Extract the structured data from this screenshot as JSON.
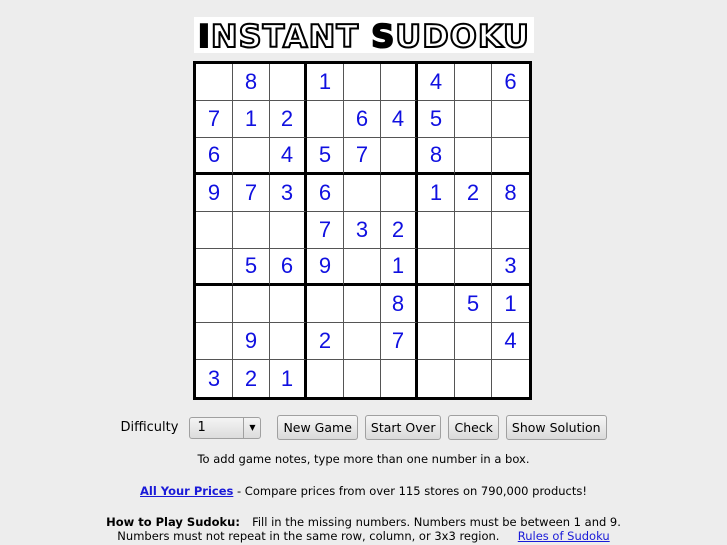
{
  "logo": {
    "text": "INSTANT SUDOKU"
  },
  "grid": [
    [
      "",
      "8",
      "",
      "1",
      "",
      "",
      "4",
      "",
      "6"
    ],
    [
      "7",
      "1",
      "2",
      "",
      "6",
      "4",
      "5",
      "",
      ""
    ],
    [
      "6",
      "",
      "4",
      "5",
      "7",
      "",
      "8",
      "",
      ""
    ],
    [
      "9",
      "7",
      "3",
      "6",
      "",
      "",
      "1",
      "2",
      "8"
    ],
    [
      "",
      "",
      "",
      "7",
      "3",
      "2",
      "",
      "",
      ""
    ],
    [
      "",
      "5",
      "6",
      "9",
      "",
      "1",
      "",
      "",
      "3"
    ],
    [
      "",
      "",
      "",
      "",
      "",
      "8",
      "",
      "5",
      "1"
    ],
    [
      "",
      "9",
      "",
      "2",
      "",
      "7",
      "",
      "",
      "4"
    ],
    [
      "3",
      "2",
      "1",
      "",
      "",
      "",
      "",
      "",
      ""
    ]
  ],
  "controls": {
    "difficulty_label": "Difficulty",
    "difficulty_value": "1",
    "new_game": "New Game",
    "start_over": "Start Over",
    "check": "Check",
    "show_solution": "Show Solution"
  },
  "notes": "To add game notes, type more than one number in a box.",
  "ad": {
    "link": "All Your Prices",
    "text": " - Compare prices from over 115 stores on 790,000 products!"
  },
  "howto": {
    "title": "How to Play Sudoku:",
    "line1": "Fill in the missing numbers. Numbers must be between 1 and 9.",
    "line2": "Numbers must not repeat in the same row, column, or 3x3 region.",
    "rules_link": "Rules of Sudoku"
  },
  "colors": {
    "digit": "#1010e0",
    "link": "#1a1ad8"
  }
}
